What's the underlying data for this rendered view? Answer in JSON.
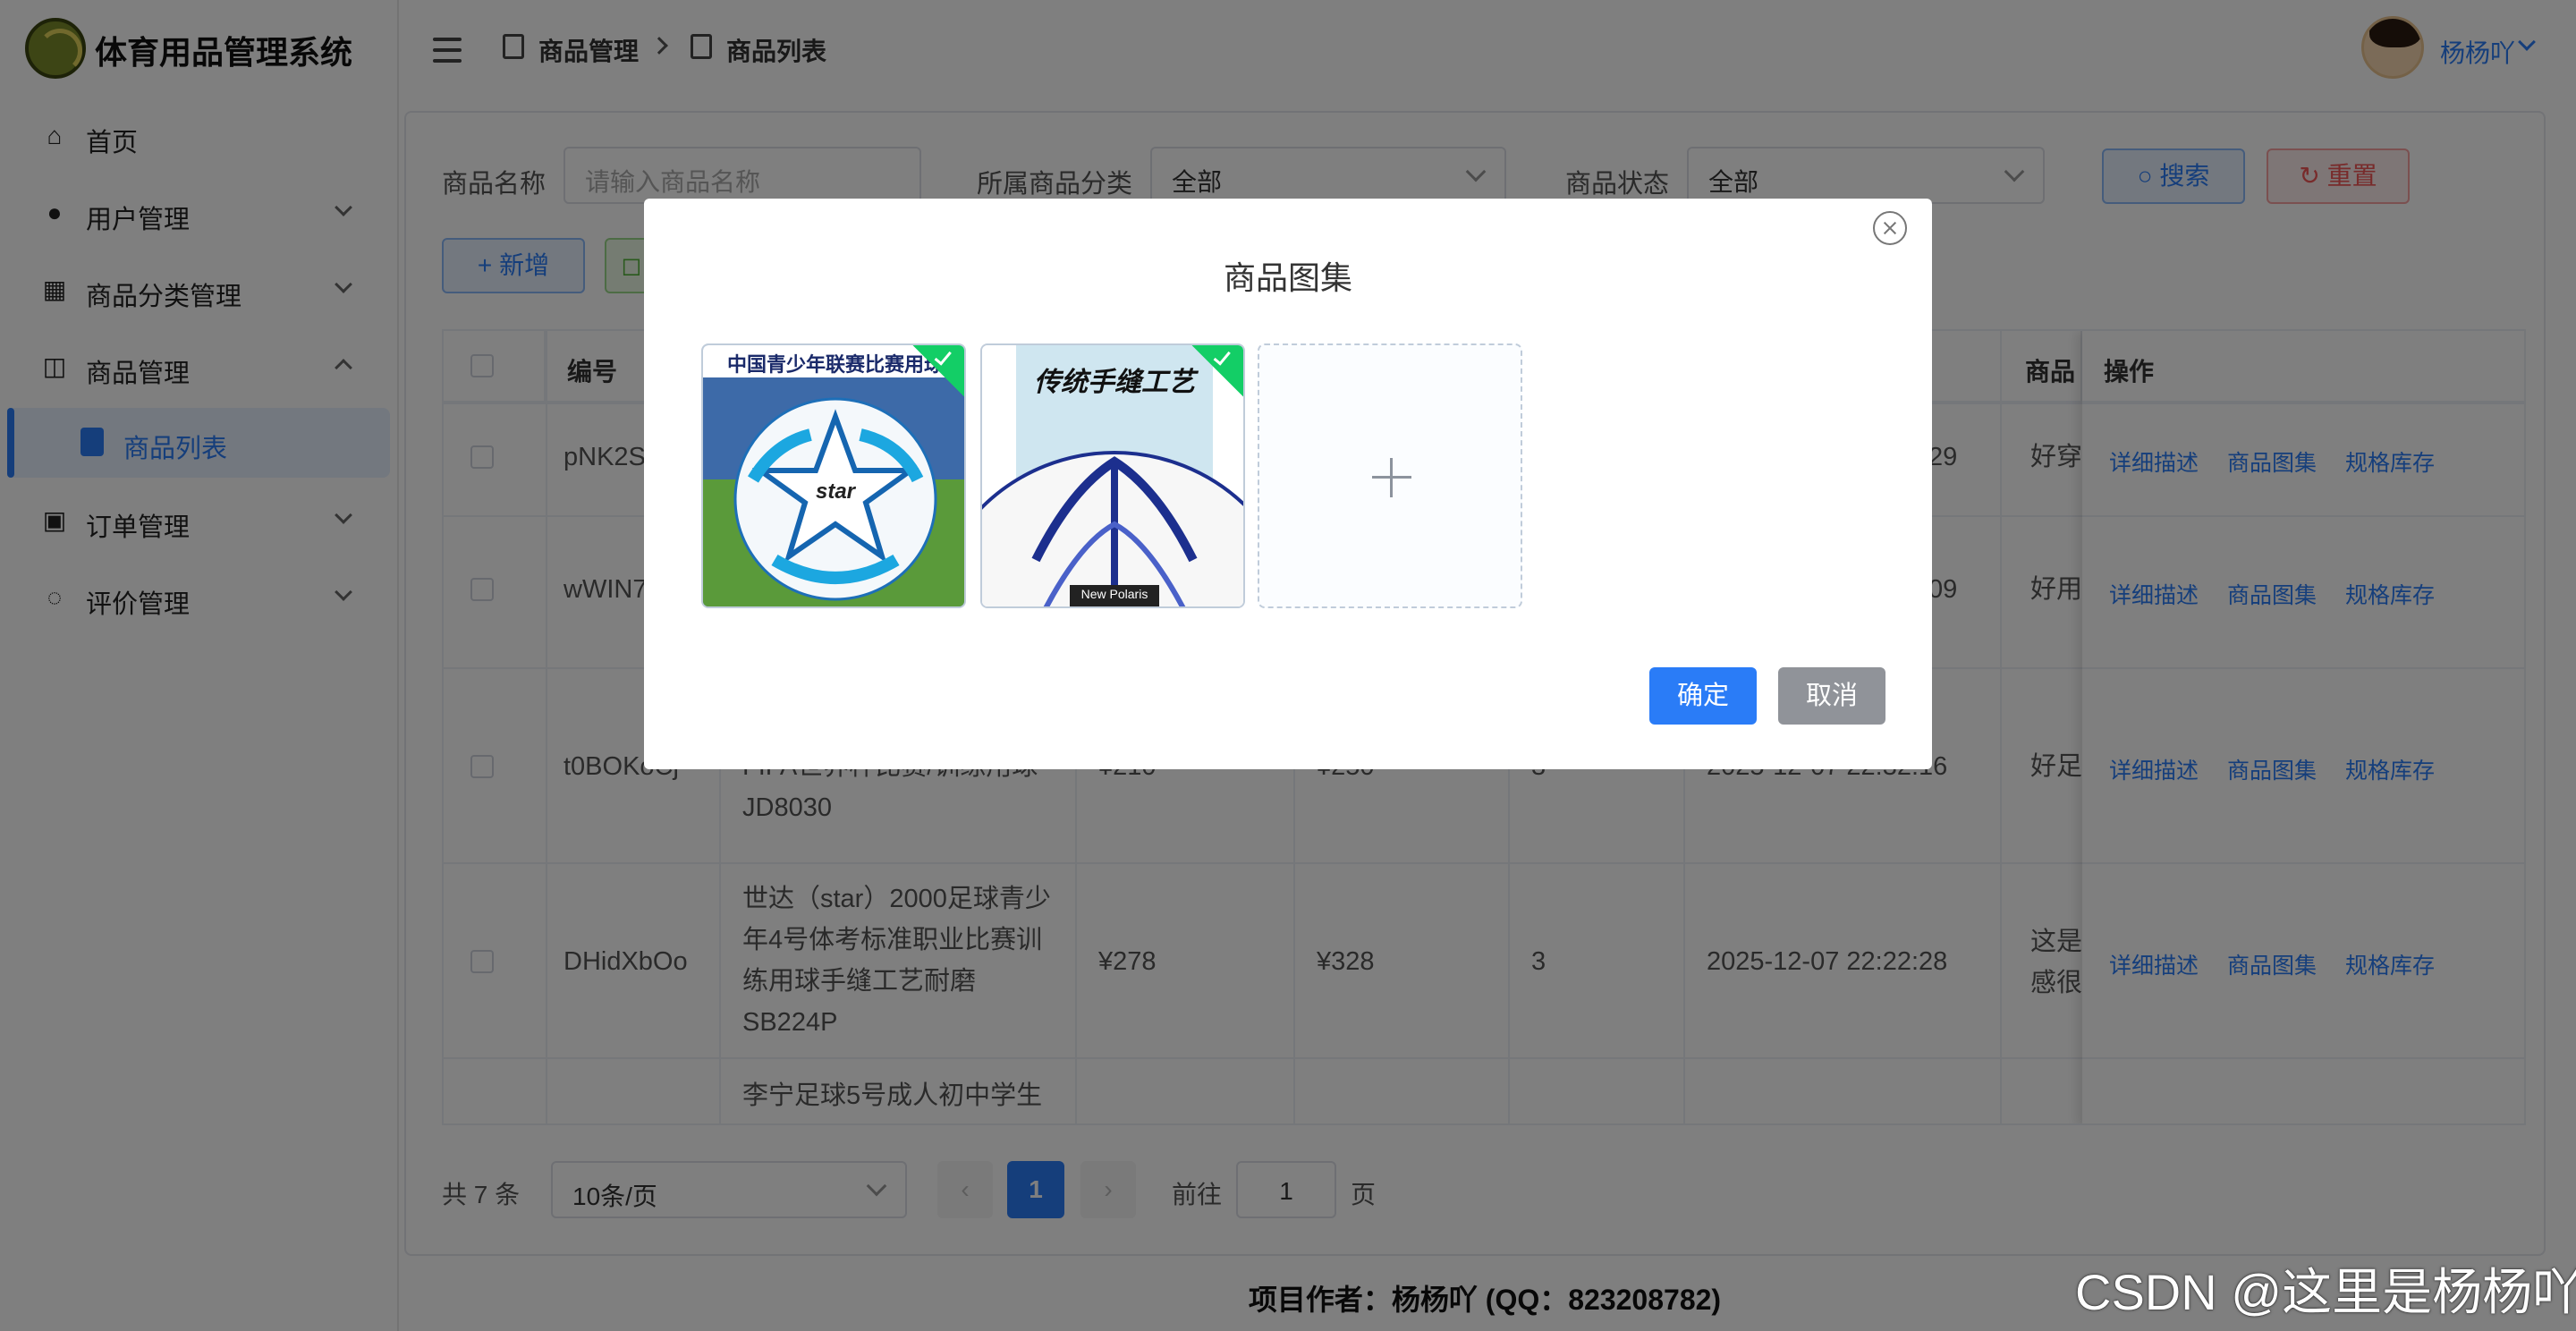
{
  "app": {
    "title": "体育用品管理系统"
  },
  "sidebar": {
    "items": [
      {
        "label": "首页"
      },
      {
        "label": "用户管理"
      },
      {
        "label": "商品分类管理"
      },
      {
        "label": "商品管理"
      },
      {
        "label": "商品列表"
      },
      {
        "label": "订单管理"
      },
      {
        "label": "评价管理"
      }
    ]
  },
  "header": {
    "breadcrumb": [
      "商品管理",
      "商品列表"
    ],
    "user": "杨杨吖"
  },
  "filters": {
    "name_label": "商品名称",
    "name_placeholder": "请输入商品名称",
    "category_label": "所属商品分类",
    "category_value": "全部",
    "status_label": "商品状态",
    "status_value": "全部",
    "search_label": "搜索",
    "reset_label": "重置",
    "add_label": "新增"
  },
  "table": {
    "headers": [
      "编号",
      "商品",
      "操作"
    ],
    "rows": [
      {
        "id": "pNK2S",
        "date": "29",
        "desc": "好穿"
      },
      {
        "id": "wWIN7",
        "date": "09",
        "desc": "好用"
      },
      {
        "id": "t0BOKoCj",
        "name": "FIFA世界杯比赛/训练用球 JD8030",
        "price": "¥210",
        "orig": "¥250",
        "stock": "3",
        "date": "2025-12-07 22:32:16",
        "desc": "好足"
      },
      {
        "id": "DHidXbOo",
        "name": "世达（star）2000足球青少年4号体考标准职业比赛训练用球手缝工艺耐磨 SB224P",
        "price": "¥278",
        "orig": "¥328",
        "stock": "3",
        "date": "2025-12-07 22:22:28",
        "desc": "这是 感很"
      },
      {
        "name": "李宁足球5号成人初中学生"
      }
    ],
    "ops": [
      "详细描述",
      "商品图集",
      "规格库存"
    ]
  },
  "pagination": {
    "total": "共 7 条",
    "size": "10条/页",
    "current": "1",
    "goto": "前往",
    "goto_value": "1",
    "unit": "页"
  },
  "footer": "项目作者：杨杨吖 (QQ：823208782)",
  "watermark": "CSDN @这里是杨杨吖",
  "dialog": {
    "title": "商品图集",
    "image1_text": "中国青少年联赛比赛用球",
    "image1_brand": "star",
    "image2_text": "传统手缝工艺",
    "image2_brand": "New Polaris",
    "ok": "确定",
    "cancel": "取消"
  },
  "colors": {
    "primary": "#2a7cf7",
    "danger": "#f05656",
    "success": "#13ce66"
  }
}
